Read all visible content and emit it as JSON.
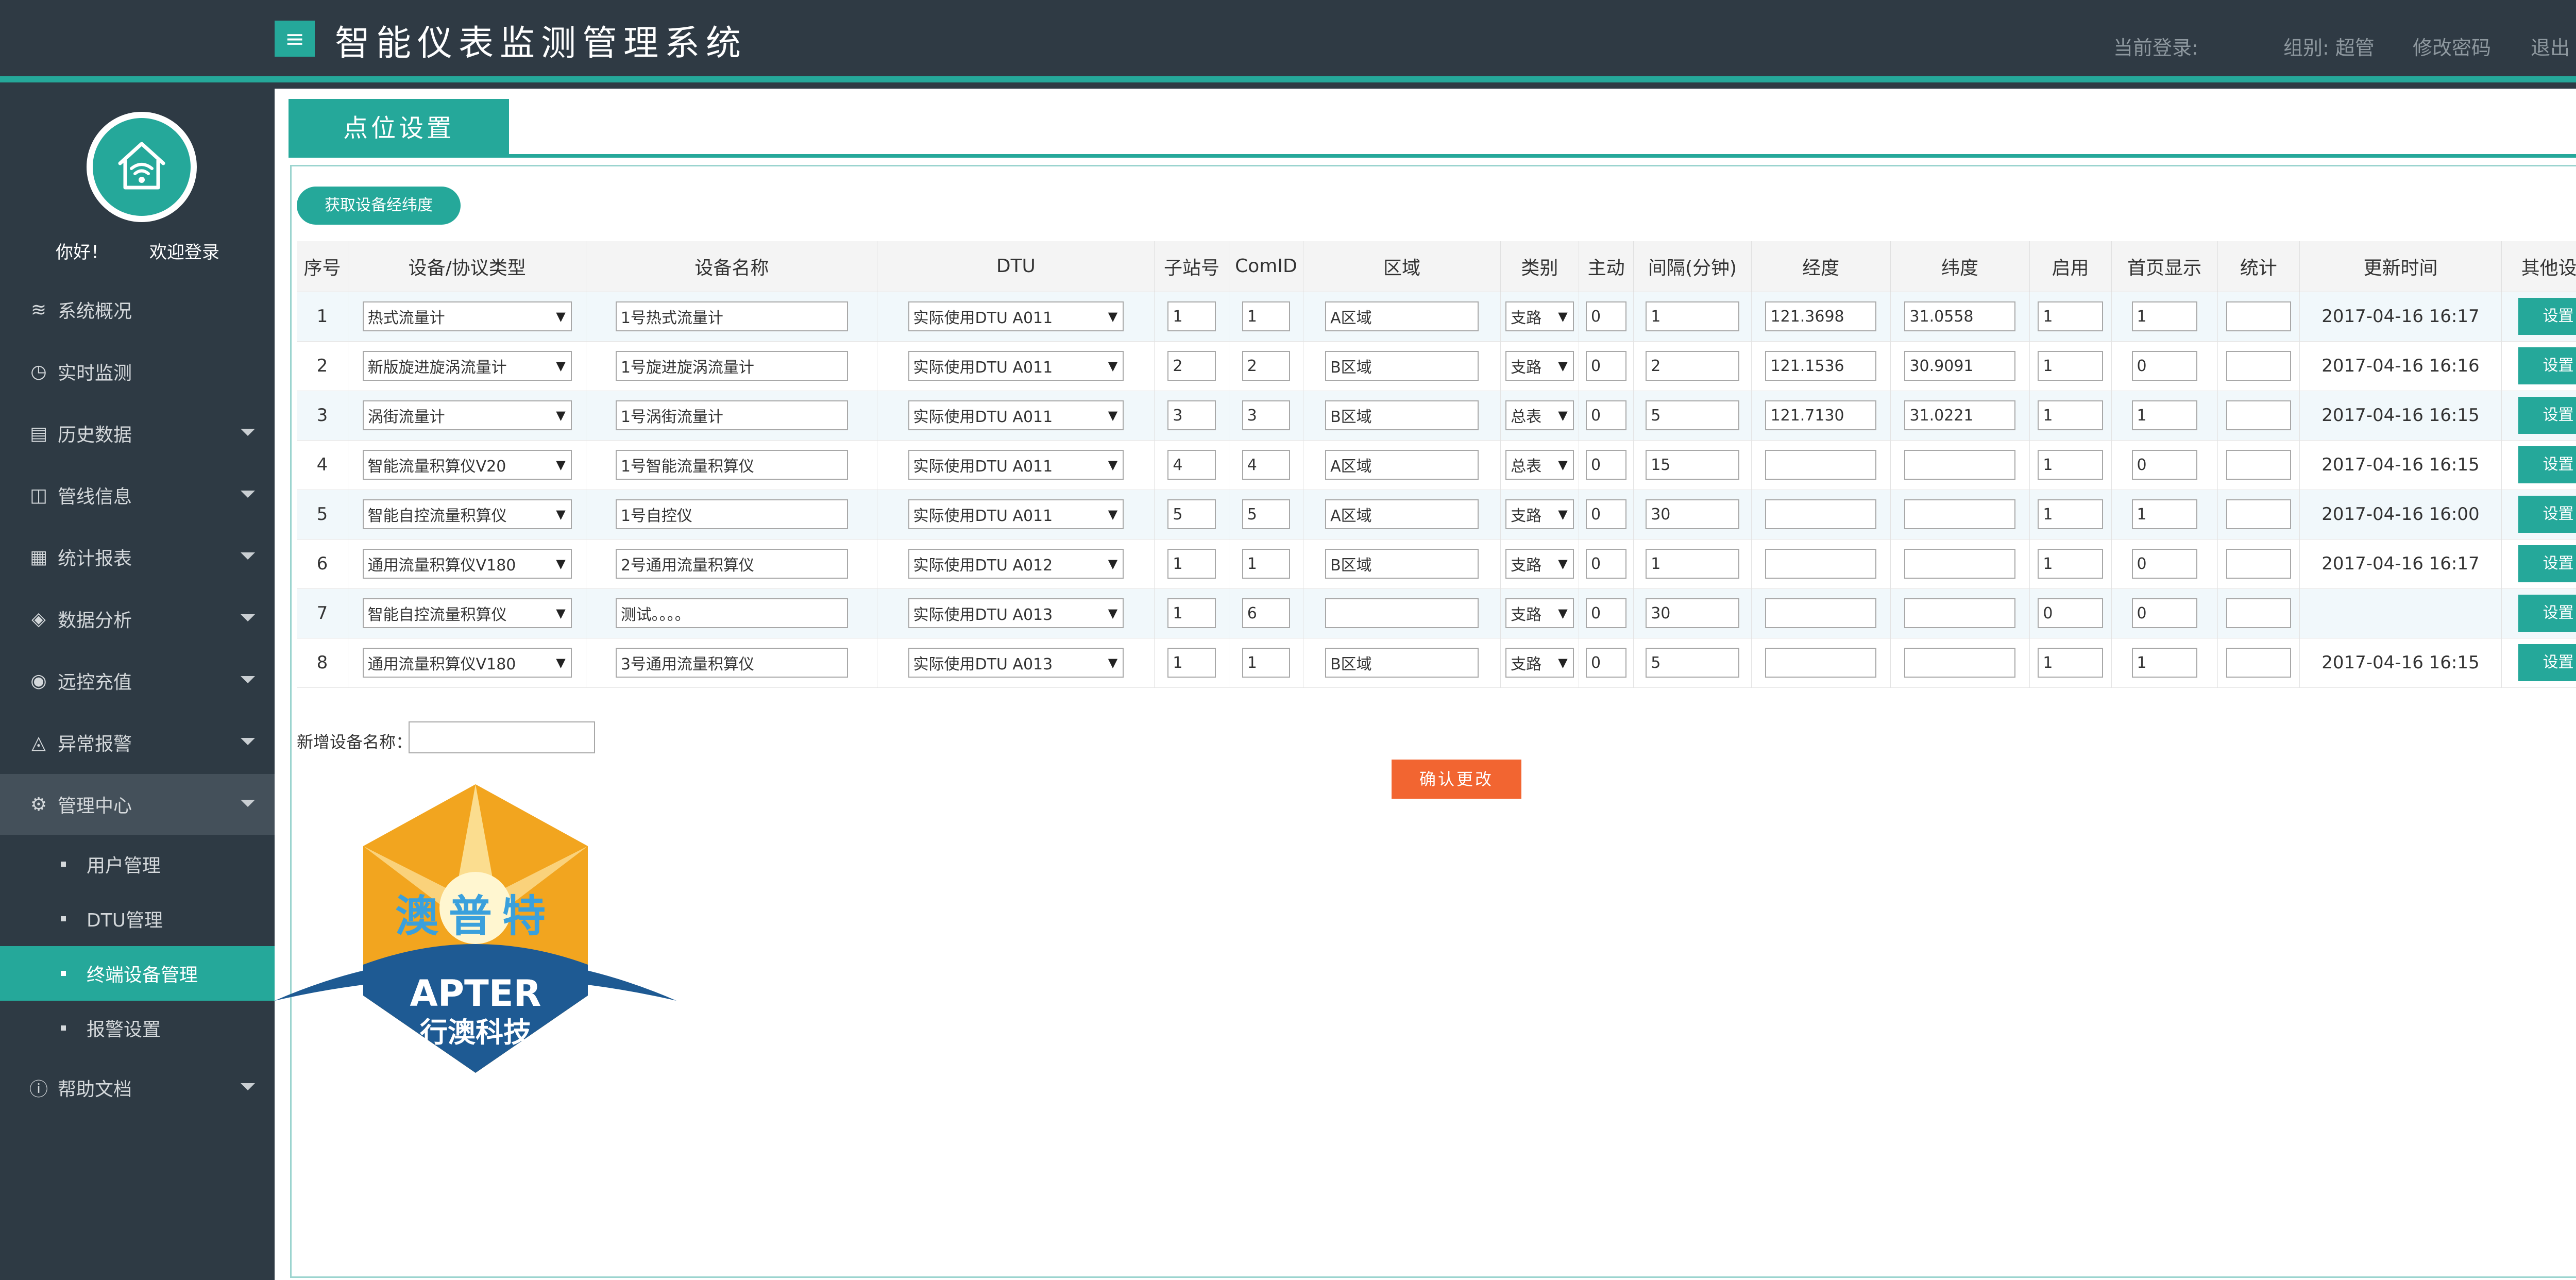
{
  "header": {
    "menu_icon": "≡",
    "title": "智能仪表监测管理系统",
    "current_login": "当前登录:",
    "group": "组别: 超管",
    "change_password": "修改密码",
    "logout": "退出"
  },
  "sidebar": {
    "greeting": "你好！",
    "welcome": "欢迎登录",
    "items": [
      {
        "label": "系统概况",
        "icon": "layers-icon",
        "glyph": "≋"
      },
      {
        "label": "实时监测",
        "icon": "clock-icon",
        "glyph": "◷"
      },
      {
        "label": "历史数据",
        "icon": "history-icon",
        "glyph": "▤"
      },
      {
        "label": "管线信息",
        "icon": "pipeline-icon",
        "glyph": "◫"
      },
      {
        "label": "统计报表",
        "icon": "report-icon",
        "glyph": "▦"
      },
      {
        "label": "数据分析",
        "icon": "analysis-icon",
        "glyph": "◈"
      },
      {
        "label": "远控充值",
        "icon": "remote-icon",
        "glyph": "◉"
      },
      {
        "label": "异常报警",
        "icon": "alarm-icon",
        "glyph": "◬"
      },
      {
        "label": "管理中心",
        "icon": "gear-icon",
        "glyph": "⚙"
      },
      {
        "label": "帮助文档",
        "icon": "info-icon",
        "glyph": "ⓘ"
      }
    ],
    "subitems": [
      "用户管理",
      "DTU管理",
      "终端设备管理",
      "报警设置"
    ]
  },
  "page": {
    "tab": "点位设置",
    "fetch_button": "获取设备经纬度",
    "new_device_label": "新增设备名称：",
    "new_device_value": "",
    "confirm_button": "确认更改"
  },
  "table": {
    "headers": [
      "序号",
      "设备/协议类型",
      "设备名称",
      "DTU",
      "子站号",
      "ComID",
      "区域",
      "类别",
      "主动",
      "间隔(分钟)",
      "经度",
      "纬度",
      "启用",
      "首页显示",
      "统计",
      "更新时间",
      "其他设置"
    ],
    "set_label": "设置",
    "rows": [
      {
        "no": "1",
        "type": "热式流量计",
        "name": "1号热式流量计",
        "dtu": "实际使用DTU A011",
        "station": "1",
        "comid": "1",
        "area": "A区域",
        "cat": "支路",
        "active": "0",
        "interval": "1",
        "lng": "121.3698",
        "lat": "31.0558",
        "enable": "1",
        "home": "1",
        "stat": "",
        "time": "2017-04-16 16:17"
      },
      {
        "no": "2",
        "type": "新版旋进旋涡流量计",
        "name": "1号旋进旋涡流量计",
        "dtu": "实际使用DTU A011",
        "station": "2",
        "comid": "2",
        "area": "B区域",
        "cat": "支路",
        "active": "0",
        "interval": "2",
        "lng": "121.1536",
        "lat": "30.9091",
        "enable": "1",
        "home": "0",
        "stat": "",
        "time": "2017-04-16 16:16"
      },
      {
        "no": "3",
        "type": "涡街流量计",
        "name": "1号涡街流量计",
        "dtu": "实际使用DTU A011",
        "station": "3",
        "comid": "3",
        "area": "B区域",
        "cat": "总表",
        "active": "0",
        "interval": "5",
        "lng": "121.7130",
        "lat": "31.0221",
        "enable": "1",
        "home": "1",
        "stat": "",
        "time": "2017-04-16 16:15"
      },
      {
        "no": "4",
        "type": "智能流量积算仪V20",
        "name": "1号智能流量积算仪",
        "dtu": "实际使用DTU A011",
        "station": "4",
        "comid": "4",
        "area": "A区域",
        "cat": "总表",
        "active": "0",
        "interval": "15",
        "lng": "",
        "lat": "",
        "enable": "1",
        "home": "0",
        "stat": "",
        "time": "2017-04-16 16:15"
      },
      {
        "no": "5",
        "type": "智能自控流量积算仪",
        "name": "1号自控仪",
        "dtu": "实际使用DTU A011",
        "station": "5",
        "comid": "5",
        "area": "A区域",
        "cat": "支路",
        "active": "0",
        "interval": "30",
        "lng": "",
        "lat": "",
        "enable": "1",
        "home": "1",
        "stat": "",
        "time": "2017-04-16 16:00"
      },
      {
        "no": "6",
        "type": "通用流量积算仪V180",
        "name": "2号通用流量积算仪",
        "dtu": "实际使用DTU A012",
        "station": "1",
        "comid": "1",
        "area": "B区域",
        "cat": "支路",
        "active": "0",
        "interval": "1",
        "lng": "",
        "lat": "",
        "enable": "1",
        "home": "0",
        "stat": "",
        "time": "2017-04-16 16:17"
      },
      {
        "no": "7",
        "type": "智能自控流量积算仪",
        "name": "测试。。。。",
        "dtu": "实际使用DTU A013",
        "station": "1",
        "comid": "6",
        "area": "",
        "cat": "支路",
        "active": "0",
        "interval": "30",
        "lng": "",
        "lat": "",
        "enable": "0",
        "home": "0",
        "stat": "",
        "time": ""
      },
      {
        "no": "8",
        "type": "通用流量积算仪V180",
        "name": "3号通用流量积算仪",
        "dtu": "实际使用DTU A013",
        "station": "1",
        "comid": "1",
        "area": "B区域",
        "cat": "支路",
        "active": "0",
        "interval": "5",
        "lng": "",
        "lat": "",
        "enable": "1",
        "home": "1",
        "stat": "",
        "time": "2017-04-16 16:15"
      }
    ]
  },
  "logo": {
    "cn_top": "澳普特",
    "en": "APTER",
    "cn_bottom": "行澳科技"
  },
  "colors": {
    "accent": "#25a89a",
    "header_bg": "#2f3a44",
    "confirm": "#f26531"
  }
}
